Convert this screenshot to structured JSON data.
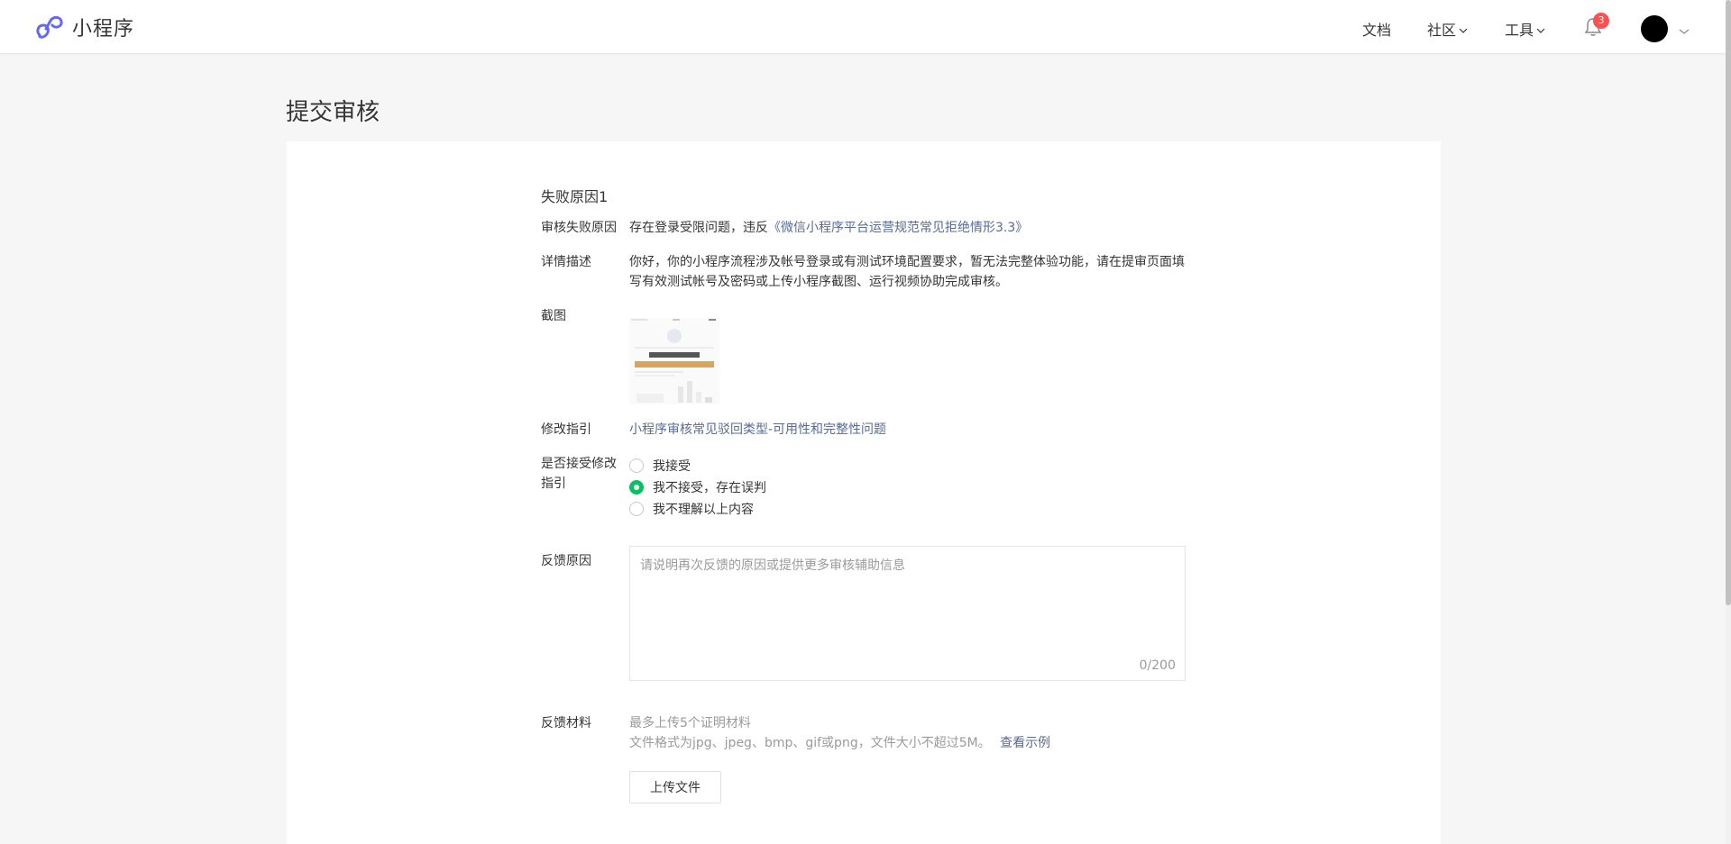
{
  "header": {
    "app_title": "小程序",
    "nav": {
      "docs": "文档",
      "community": "社区",
      "tools": "工具"
    },
    "notification_count": "3"
  },
  "page": {
    "title": "提交审核"
  },
  "review": {
    "section_title": "失败原因1",
    "failure_reason_label": "审核失败原因",
    "failure_reason_text": "存在登录受限问题，违反",
    "failure_reason_link": "《微信小程序平台运营规范常见拒绝情形3.3》",
    "detail_label": "详情描述",
    "detail_text": "你好，你的小程序流程涉及帐号登录或有测试环境配置要求，暂无法完整体验功能，请在提审页面填写有效测试帐号及密码或上传小程序截图、运行视频协助完成审核。",
    "screenshot_label": "截图",
    "guide_label": "修改指引",
    "guide_link": "小程序审核常见驳回类型-可用性和完整性问题",
    "accept_label": "是否接受修改指引",
    "options": [
      {
        "label": "我接受",
        "checked": false
      },
      {
        "label": "我不接受，存在误判",
        "checked": true
      },
      {
        "label": "我不理解以上内容",
        "checked": false
      }
    ],
    "feedback_label": "反馈原因",
    "feedback_placeholder": "请说明再次反馈的原因或提供更多审核辅助信息",
    "feedback_counter": "0/200",
    "material_label": "反馈材料",
    "material_hint1": "最多上传5个证明材料",
    "material_hint2": "文件格式为jpg、jpeg、bmp、gif或png，文件大小不超过5M。",
    "material_example_link": "查看示例",
    "upload_button": "上传文件"
  },
  "colors": {
    "link": "#576b95",
    "radio_checked": "#07c160",
    "badge": "#fa5151",
    "brand": "#6467f0"
  }
}
